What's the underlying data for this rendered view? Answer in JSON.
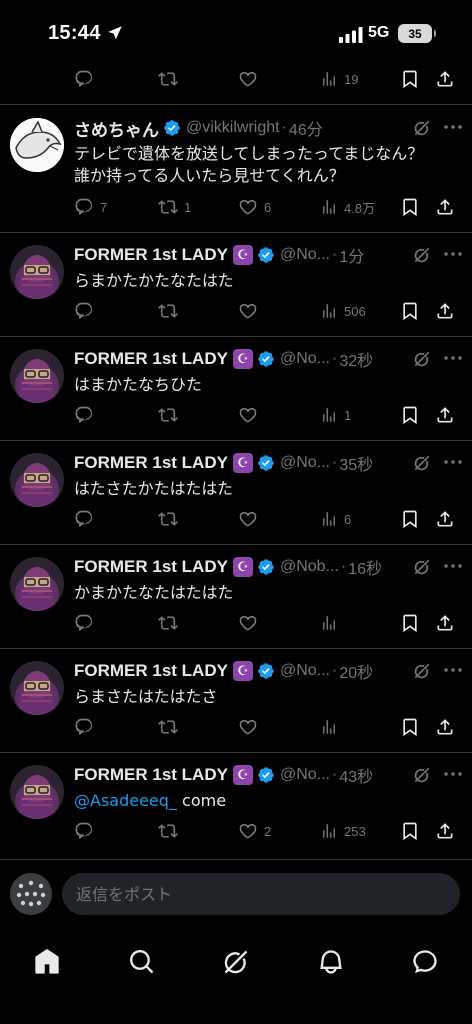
{
  "status_bar": {
    "time": "15:44",
    "network": "5G",
    "battery": "35"
  },
  "top_partial": {
    "views": "19"
  },
  "tweets": [
    {
      "name": "さめちゃん",
      "handle": "@vikkilwright",
      "time": "46分",
      "text": "テレビで遺体を放送してしまったってまじなん？\n誰か持ってる人いたら見せてくれん？",
      "replies": "7",
      "retweets": "1",
      "likes": "6",
      "views": "4.8万"
    },
    {
      "name": "FORMER 1st LADY",
      "handle": "@No...",
      "time": "1分",
      "text": "らまかたかたなたはた",
      "replies": "",
      "retweets": "",
      "likes": "",
      "views": "506"
    },
    {
      "name": "FORMER 1st LADY",
      "handle": "@No...",
      "time": "32秒",
      "text": "はまかたなちひた",
      "replies": "",
      "retweets": "",
      "likes": "",
      "views": "1"
    },
    {
      "name": "FORMER 1st LADY",
      "handle": "@No...",
      "time": "35秒",
      "text": "はたさたかたはたはた",
      "replies": "",
      "retweets": "",
      "likes": "",
      "views": "6"
    },
    {
      "name": "FORMER 1st LADY",
      "handle": "@Nob...",
      "time": "16秒",
      "text": "かまかたなたはたはた",
      "replies": "",
      "retweets": "",
      "likes": "",
      "views": ""
    },
    {
      "name": "FORMER 1st LADY",
      "handle": "@No...",
      "time": "20秒",
      "text": "らまさたはたはたさ",
      "replies": "",
      "retweets": "",
      "likes": "",
      "views": ""
    },
    {
      "name": "FORMER 1st LADY",
      "handle": "@No...",
      "time": "43秒",
      "mention": "@Asadeeeq_",
      "text": " come",
      "replies": "",
      "retweets": "",
      "likes": "2",
      "views": "253"
    }
  ],
  "reply_bar": {
    "placeholder": "返信をポスト"
  },
  "nav": [
    "home-icon",
    "search-icon",
    "grok-icon",
    "notifications-icon",
    "messages-icon"
  ],
  "colors": {
    "background": "#000000",
    "text": "#e7e9ea",
    "secondary": "#71767b",
    "accent": "#1d9bf0",
    "divider": "#2f3336"
  }
}
